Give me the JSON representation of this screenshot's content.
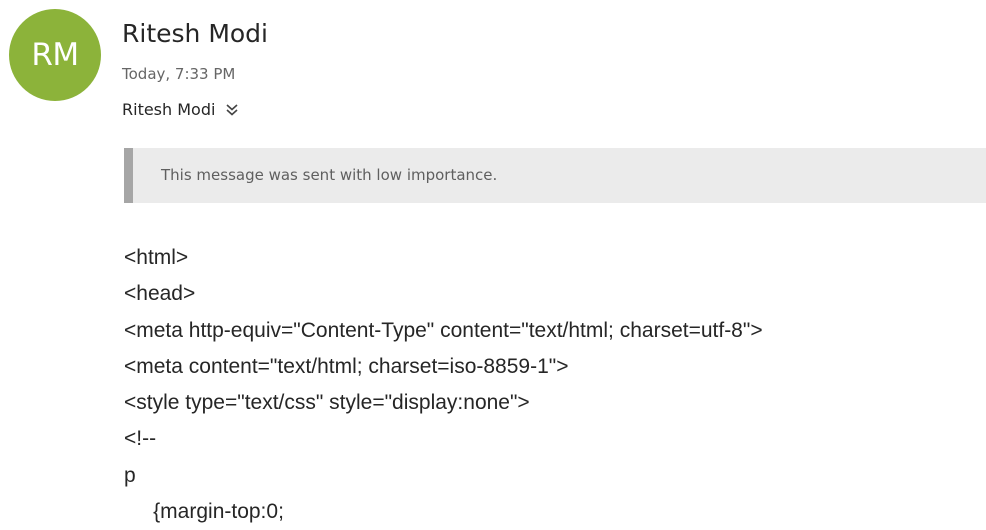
{
  "sender": {
    "initials": "RM",
    "name": "Ritesh Modi",
    "avatar_color": "#8cb33a"
  },
  "sent_time": "Today, 7:33 PM",
  "recipient": {
    "name": "Ritesh Modi",
    "expand_icon": "double-chevron-down-icon"
  },
  "importance_notice": {
    "text": "This message was sent with low importance.",
    "bar_color": "#ebebeb",
    "accent_color": "#a6a6a6"
  },
  "body_lines": [
    "<html>",
    "<head>",
    "<meta http-equiv=\"Content-Type\" content=\"text/html; charset=utf-8\">",
    "<meta content=\"text/html; charset=iso-8859-1\">",
    "<style type=\"text/css\" style=\"display:none\">",
    "<!--",
    "p",
    "     {margin-top:0;"
  ]
}
